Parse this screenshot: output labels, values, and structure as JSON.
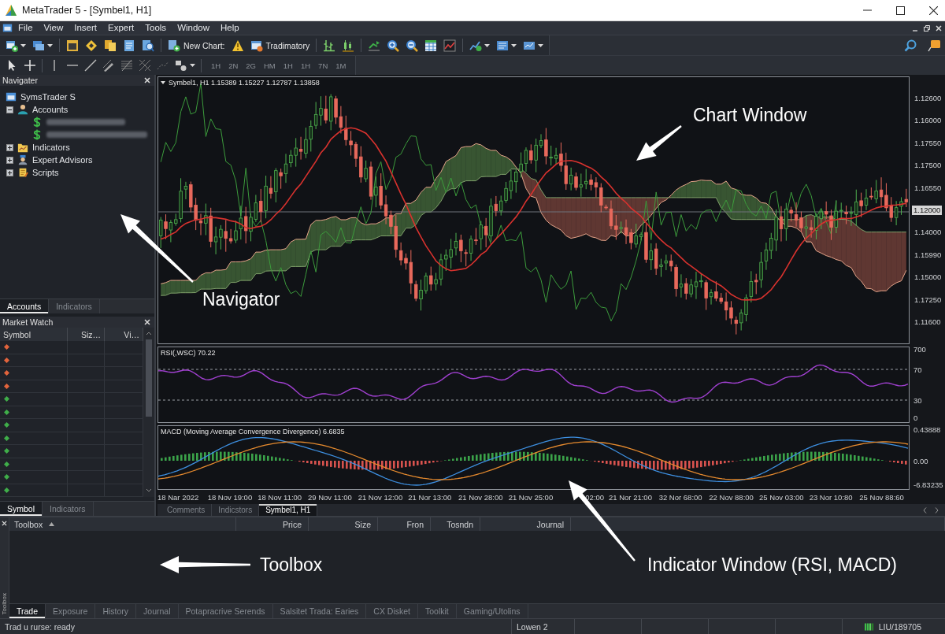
{
  "window": {
    "title": "MetaTrader 5 - [Symbel1, H1]"
  },
  "menu": [
    "File",
    "View",
    "Insert",
    "Expert",
    "Tools",
    "Window",
    "Help"
  ],
  "toolbar": {
    "new_chart": "New Chart:",
    "profile": "Tradimatory",
    "timeframes": [
      "1H",
      "2N",
      "2G",
      "HM",
      "1H",
      "1H",
      "7N",
      "1M"
    ]
  },
  "navigator": {
    "title": "Navigater",
    "tree": [
      {
        "label": "SymsTrader S",
        "kind": "terminal",
        "children": [
          {
            "label": "Accounts",
            "kind": "accounts",
            "expanded": true,
            "children": [
              {
                "kind": "account"
              },
              {
                "kind": "account"
              }
            ]
          },
          {
            "label": "Indicators",
            "kind": "indicators",
            "expanded": false
          },
          {
            "label": "Expert Advisors",
            "kind": "experts",
            "expanded": false
          },
          {
            "label": "Scripts",
            "kind": "scripts",
            "expanded": false
          }
        ]
      }
    ],
    "tabs": [
      {
        "label": "Accounts",
        "selected": true
      },
      {
        "label": "Indicators",
        "selected": false
      }
    ]
  },
  "market_watch": {
    "title": "Market Watch",
    "columns": [
      "Symbol",
      "Siz…",
      "Vi…"
    ],
    "rows": [
      {
        "color": "#e2643c"
      },
      {
        "color": "#e2643c"
      },
      {
        "color": "#e2643c"
      },
      {
        "color": "#e2643c"
      },
      {
        "color": "#3fae49"
      },
      {
        "color": "#3fae49"
      },
      {
        "color": "#3fae49"
      },
      {
        "color": "#3fae49"
      },
      {
        "color": "#3fae49"
      },
      {
        "color": "#3fae49"
      },
      {
        "color": "#3fae49"
      },
      {
        "color": "#3fae49"
      }
    ],
    "tabs": [
      {
        "label": "Symbol",
        "selected": true
      },
      {
        "label": "Indicators",
        "selected": false
      }
    ]
  },
  "chart": {
    "header": "Symbel1, H1 1.15389 1.15227 1.12787 1.13858",
    "price_axis": [
      {
        "text": "1.12600",
        "kind": "tick"
      },
      {
        "text": "1.16000",
        "kind": "tick"
      },
      {
        "text": "1.17550",
        "kind": "tick"
      },
      {
        "text": "1.17500",
        "kind": "tick"
      },
      {
        "text": "1.16550",
        "kind": "tick"
      },
      {
        "text": "1.12000",
        "kind": "current"
      },
      {
        "text": "1.14000",
        "kind": "tick"
      },
      {
        "text": "1.15990",
        "kind": "tick"
      },
      {
        "text": "1.15000",
        "kind": "tick"
      },
      {
        "text": "1.17250",
        "kind": "tick"
      },
      {
        "text": "1.11600",
        "kind": "tick"
      }
    ],
    "rsi": {
      "header": "RSI(,WSC) 70.22",
      "axis": [
        "700",
        "70",
        "30",
        "0"
      ]
    },
    "macd": {
      "header": "MACD (Moving Average Convergence Divergence) 6.6835",
      "axis": [
        "0.43888",
        "0.00",
        "-6.83235"
      ]
    },
    "time_axis": [
      "18 Nar 2022",
      "18 Nov 19:00",
      "18 Nov 11:00",
      "29 Nov 11:00",
      "21 Nov 12:00",
      "21 Nor 13:00",
      "21 Nov 28:00",
      "21 Nov 25:00",
      "02:00",
      "21 Nor 21:00",
      "32 Nor 68:00",
      "22 Nov 88:00",
      "25 Nov 03:00",
      "23 Nor 10:80",
      "25 Nov 88:60"
    ],
    "tabs": [
      {
        "label": "Comments",
        "selected": false
      },
      {
        "label": "Indicstors",
        "selected": false
      },
      {
        "label": "Symbel1, H1",
        "selected": true
      }
    ]
  },
  "toolbox": {
    "side_label": "Toolbox",
    "columns": [
      {
        "label": "Toolbox",
        "sorted": true
      },
      {
        "label": "Price",
        "sorted": false
      },
      {
        "label": "Size",
        "sorted": false
      },
      {
        "label": "Fron",
        "sorted": false
      },
      {
        "label": "Tosndn",
        "sorted": false
      },
      {
        "label": "Journal",
        "sorted": false
      }
    ],
    "tabs": [
      {
        "label": "Trade",
        "selected": true
      },
      {
        "label": "Exposure",
        "selected": false
      },
      {
        "label": "History",
        "selected": false
      },
      {
        "label": "Journal",
        "selected": false
      },
      {
        "label": "Potapracrive Serends",
        "selected": false
      },
      {
        "label": "Salsitet Trada: Earies",
        "selected": false
      },
      {
        "label": "CX Disket",
        "selected": false
      },
      {
        "label": "Toolkit",
        "selected": false
      },
      {
        "label": "Gaming/Utolins",
        "selected": false
      }
    ]
  },
  "status_bar": {
    "status": "Trad u rurse: ready",
    "cell_2": "Lowen 2",
    "connection": "LIU/189705"
  },
  "annotations": [
    {
      "text": "Chart Window"
    },
    {
      "text": "Navigator"
    },
    {
      "text": "Toolbox"
    },
    {
      "text": "Indicator Window (RSI, MACD)"
    }
  ]
}
